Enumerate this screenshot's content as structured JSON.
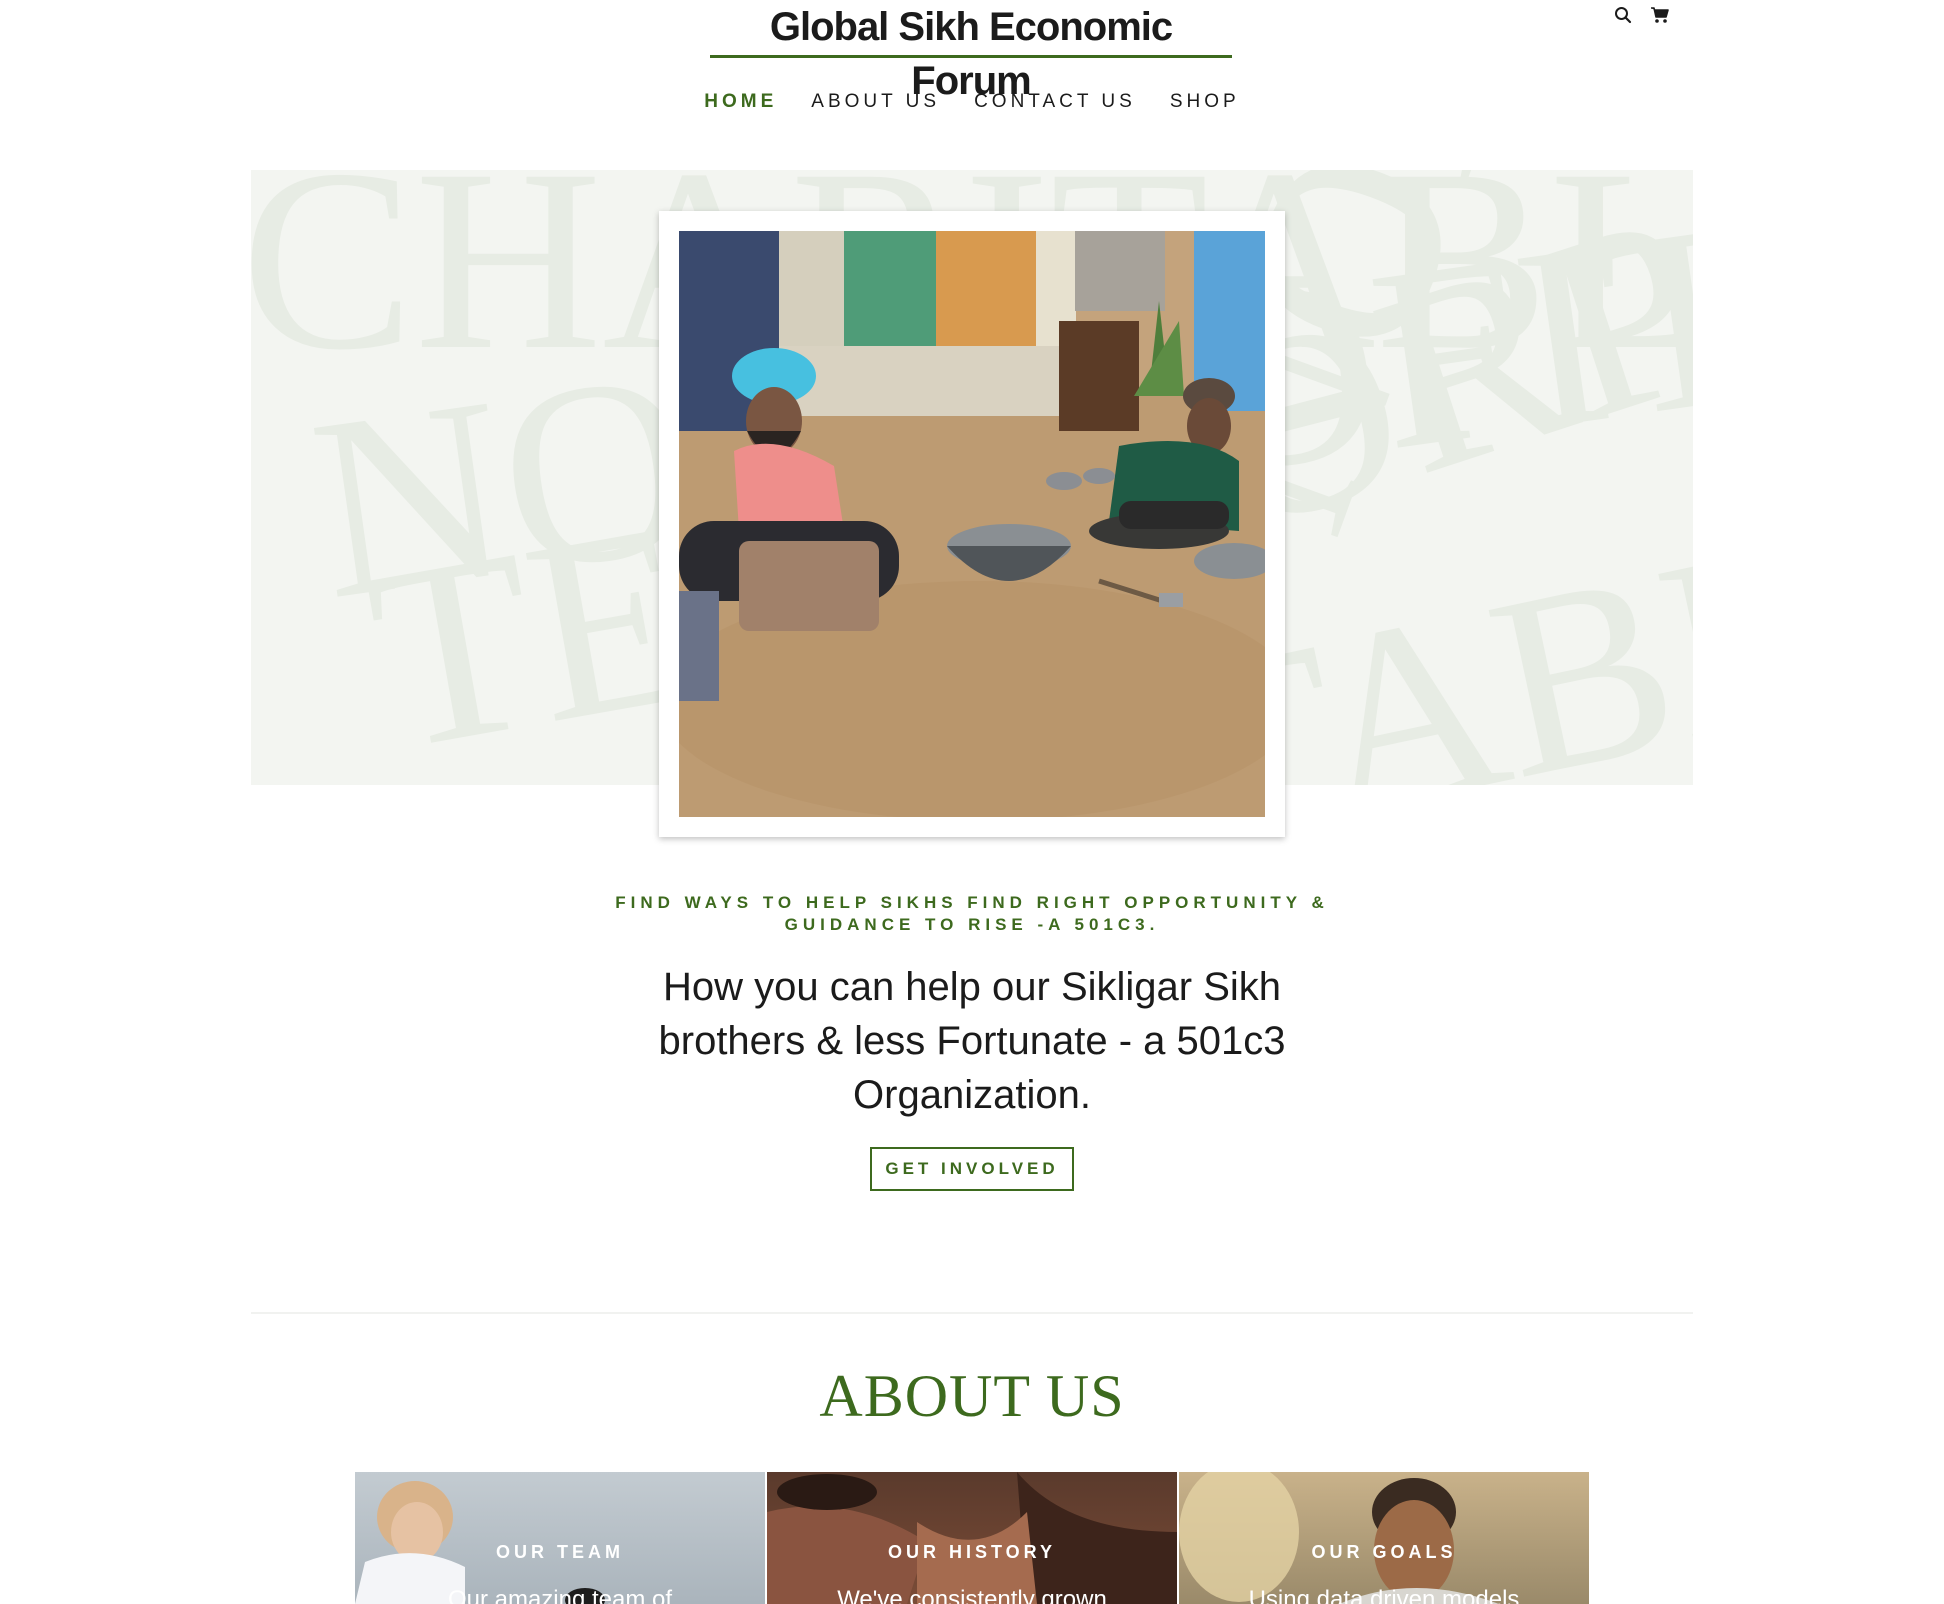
{
  "header": {
    "site_title": "Global Sikh Economic Forum"
  },
  "nav": {
    "items": [
      {
        "label": "HOME",
        "active": true
      },
      {
        "label": "ABOUT US",
        "active": false
      },
      {
        "label": "CONTACT US",
        "active": false
      },
      {
        "label": "SHOP",
        "active": false
      }
    ]
  },
  "hero": {
    "background_words": [
      "CHARITABLE",
      "NONPROFIT",
      "TEAM",
      "CHARITABLE",
      "NONPROFIT",
      "CORPORATE"
    ],
    "kicker": "FIND WAYS TO HELP SIKHS FIND RIGHT OPPORTUNITY & GUIDANCE TO RISE -A 501C3.",
    "headline": "How you can help our Sikligar Sikh brothers & less Fortunate - a 501c3 Organization.",
    "cta_label": "GET INVOLVED"
  },
  "about": {
    "title": "ABOUT US",
    "cards": [
      {
        "label": "OUR TEAM",
        "sub": "Our amazing team of"
      },
      {
        "label": "OUR HISTORY",
        "sub": "We've consistently grown"
      },
      {
        "label": "OUR GOALS",
        "sub": "Using data driven models"
      }
    ]
  },
  "icons": {
    "search": "search-icon",
    "cart": "cart-icon"
  },
  "colors": {
    "accent": "#3d6a1e",
    "hero_band": "#f3f5f1",
    "text": "#1b1b1b"
  }
}
